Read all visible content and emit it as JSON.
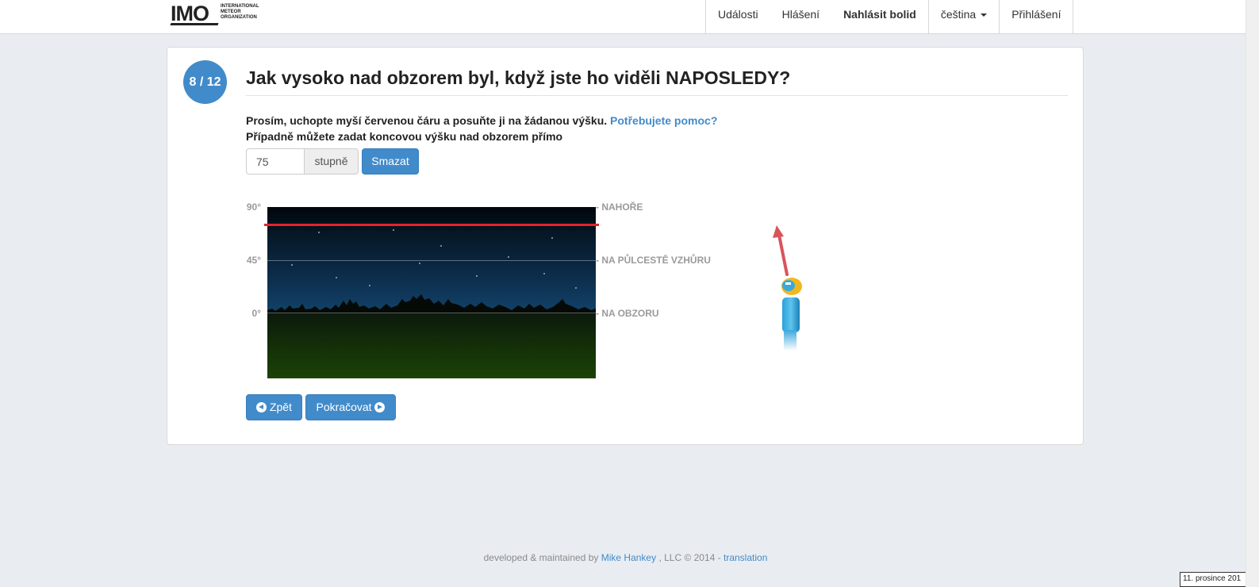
{
  "brand": {
    "name": "IMO",
    "subtitle_lines": [
      "INTERNATIONAL",
      "METEOR",
      "ORGANIZATION"
    ]
  },
  "nav": {
    "items": [
      {
        "label": "Události"
      },
      {
        "label": "Hlášení"
      },
      {
        "label": "Nahlásit bolid"
      },
      {
        "label": "čeština"
      },
      {
        "label": "Přihlášení"
      }
    ]
  },
  "step": {
    "badge": "8 / 12",
    "question": "Jak vysoko nad obzorem byl, když jste ho viděli NAPOSLEDY?",
    "instruction_1": "Prosím, uchopte myší červenou čáru a posuňte ji na žádanou výšku.",
    "help_link": "Potřebujete pomoc?",
    "instruction_2": "Případně můžete zadat koncovou výšku nad obzorem přímo"
  },
  "altitude_input": {
    "value": "75",
    "unit": "stupně",
    "clear_button": "Smazat"
  },
  "sky_scale": {
    "ticks": [
      {
        "label": "90°",
        "zone": "NAHOŘE"
      },
      {
        "label": "45°",
        "zone": "NA PŮLCESTĚ VZHŮRU"
      },
      {
        "label": "0°",
        "zone": "NA OBZORU"
      }
    ],
    "selected_altitude_deg": 75
  },
  "colors": {
    "accent": "#428bca",
    "slider_line": "#e1252b",
    "page_bg": "#e9edf1"
  },
  "buttons": {
    "back": "Zpět",
    "continue": "Pokračovat"
  },
  "footer": {
    "prefix": "developed & maintained by",
    "author_link": "Mike Hankey",
    "suffix": ", LLC © 2014 -",
    "translation_link": "translation",
    "date_stamp": "11. prosince 201"
  }
}
